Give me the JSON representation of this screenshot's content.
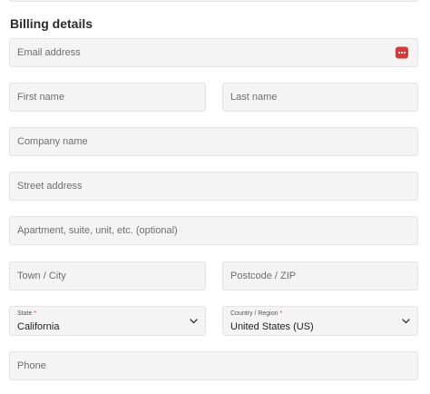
{
  "section": {
    "title": "Billing details"
  },
  "fields": {
    "email": {
      "placeholder": "Email address"
    },
    "first_name": {
      "placeholder": "First name"
    },
    "last_name": {
      "placeholder": "Last name"
    },
    "company": {
      "placeholder": "Company name"
    },
    "street": {
      "placeholder": "Street address"
    },
    "apartment": {
      "placeholder": "Apartment, suite, unit, etc. (optional)"
    },
    "town": {
      "placeholder": "Town / City"
    },
    "postcode": {
      "placeholder": "Postcode / ZIP"
    },
    "state": {
      "label": "State",
      "required_mark": "*",
      "value": "California"
    },
    "country": {
      "label": "Country / Region",
      "required_mark": "*",
      "value": "United States (US)"
    },
    "phone": {
      "placeholder": "Phone"
    }
  },
  "icons": {
    "email_action": "password-manager-icon",
    "select_arrow": "chevron-down-icon"
  },
  "colors": {
    "field_background": "#f4f4f4",
    "field_border": "#e4e4e4",
    "required": "#d6322a",
    "password_manager": "#d43a3a"
  }
}
